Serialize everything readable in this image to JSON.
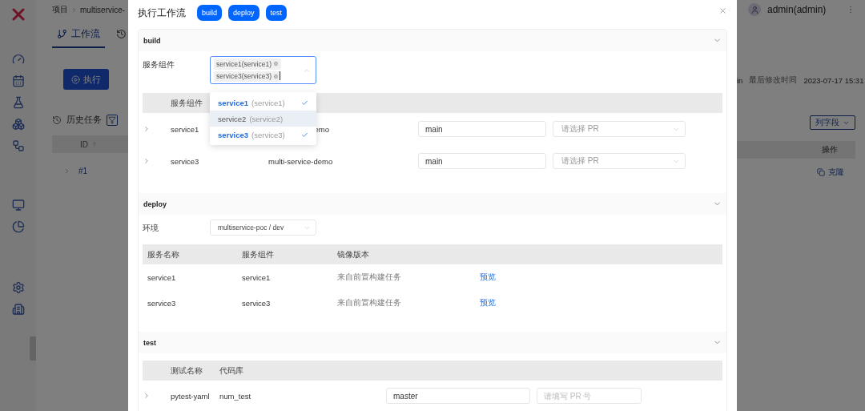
{
  "background_app": {
    "breadcrumb": [
      "项目",
      "multiservice-"
    ],
    "tabs": [
      {
        "label": "工作流",
        "selected": true
      },
      {
        "selected": false
      }
    ],
    "run_button": "执行",
    "history_title": "历史任务",
    "table": {
      "columns": [
        "ID"
      ],
      "rows": [
        {
          "id": "#1",
          "expanded": false
        }
      ]
    },
    "user": "admin(admin)",
    "meta": {
      "owner_fragment": "in",
      "modified_label": "最后修改时间",
      "modified_value": "2023-07-17 15:31"
    },
    "columns_button": "列字段",
    "actions_column": "操作",
    "clone_link": "克隆"
  },
  "drawer": {
    "title": "执行工作流",
    "jump_buttons": [
      "build",
      "deploy",
      "test"
    ],
    "sections": [
      {
        "kind": "build",
        "title": "build",
        "expanded": true,
        "field_label": "服务组件",
        "selected_tags": [
          "service1(service1)",
          "service3(service3)"
        ],
        "dropdown": {
          "open": true,
          "options": [
            {
              "name": "service1",
              "alias": "(service1)",
              "selected": true,
              "highlighted": false
            },
            {
              "name": "service2",
              "alias": "(service2)",
              "selected": false,
              "highlighted": true
            },
            {
              "name": "service3",
              "alias": "(service3)",
              "selected": true,
              "highlighted": false
            }
          ]
        },
        "table": {
          "columns": [
            "服务组件"
          ],
          "rows": [
            {
              "service": "service1",
              "repo": "emo",
              "branch": "main",
              "pr_placeholder": "请选择 PR",
              "expanded": false
            },
            {
              "service": "service3",
              "repo": "multi-service-demo",
              "branch": "main",
              "pr_placeholder": "请选择 PR",
              "expanded": false
            }
          ]
        }
      },
      {
        "kind": "deploy",
        "title": "deploy",
        "expanded": true,
        "env_label": "环境",
        "env_value": "multiservice-poc / dev",
        "table": {
          "columns": [
            "服务名称",
            "服务组件",
            "镜像版本"
          ],
          "rows": [
            {
              "service": "service1",
              "component": "service1",
              "image": "来自前置构建任务",
              "action": "预览"
            },
            {
              "service": "service3",
              "component": "service3",
              "image": "来自前置构建任务",
              "action": "预览"
            }
          ]
        }
      },
      {
        "kind": "test",
        "title": "test",
        "expanded": true,
        "table": {
          "columns": [
            "测试名称",
            "代码库"
          ],
          "rows": [
            {
              "name": "pytest-yaml",
              "repo": "num_test",
              "branch": "master",
              "pr_placeholder": "请填写 PR 号",
              "expanded": false
            }
          ]
        }
      }
    ]
  }
}
